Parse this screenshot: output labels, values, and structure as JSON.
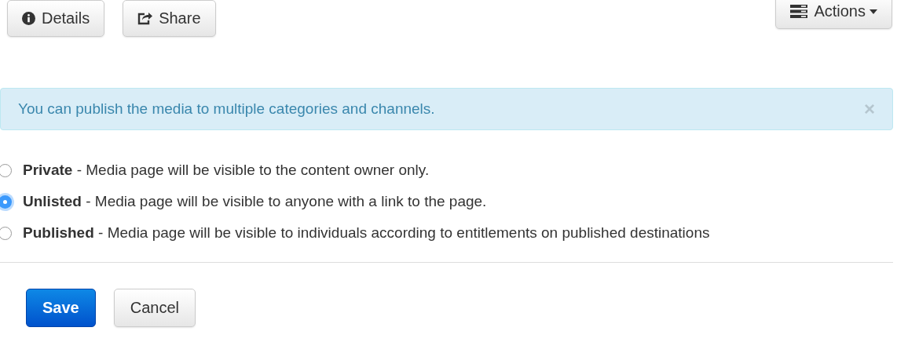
{
  "toolbar": {
    "buttons": [
      {
        "label": "Details",
        "kind": "info"
      },
      {
        "label": "Share",
        "kind": "share"
      }
    ],
    "actions": {
      "label": "Actions"
    }
  },
  "alert": {
    "text": "You can publish the media to multiple categories and channels.",
    "close": "×"
  },
  "visibility": [
    {
      "label": "**Private** - Media page will be visible to the content owner only.",
      "selected": false
    },
    {
      "label": "**Unlisted** - Media page will be visible to anyone with a link to the page.",
      "selected": true
    },
    {
      "label": "**Published** - Media page will be visible to individuals according to entitlements on published destinations",
      "selected": false
    }
  ],
  "form_buttons": [
    {
      "label": "Save",
      "kind": "primary"
    },
    {
      "label": "Cancel",
      "kind": "default"
    }
  ]
}
